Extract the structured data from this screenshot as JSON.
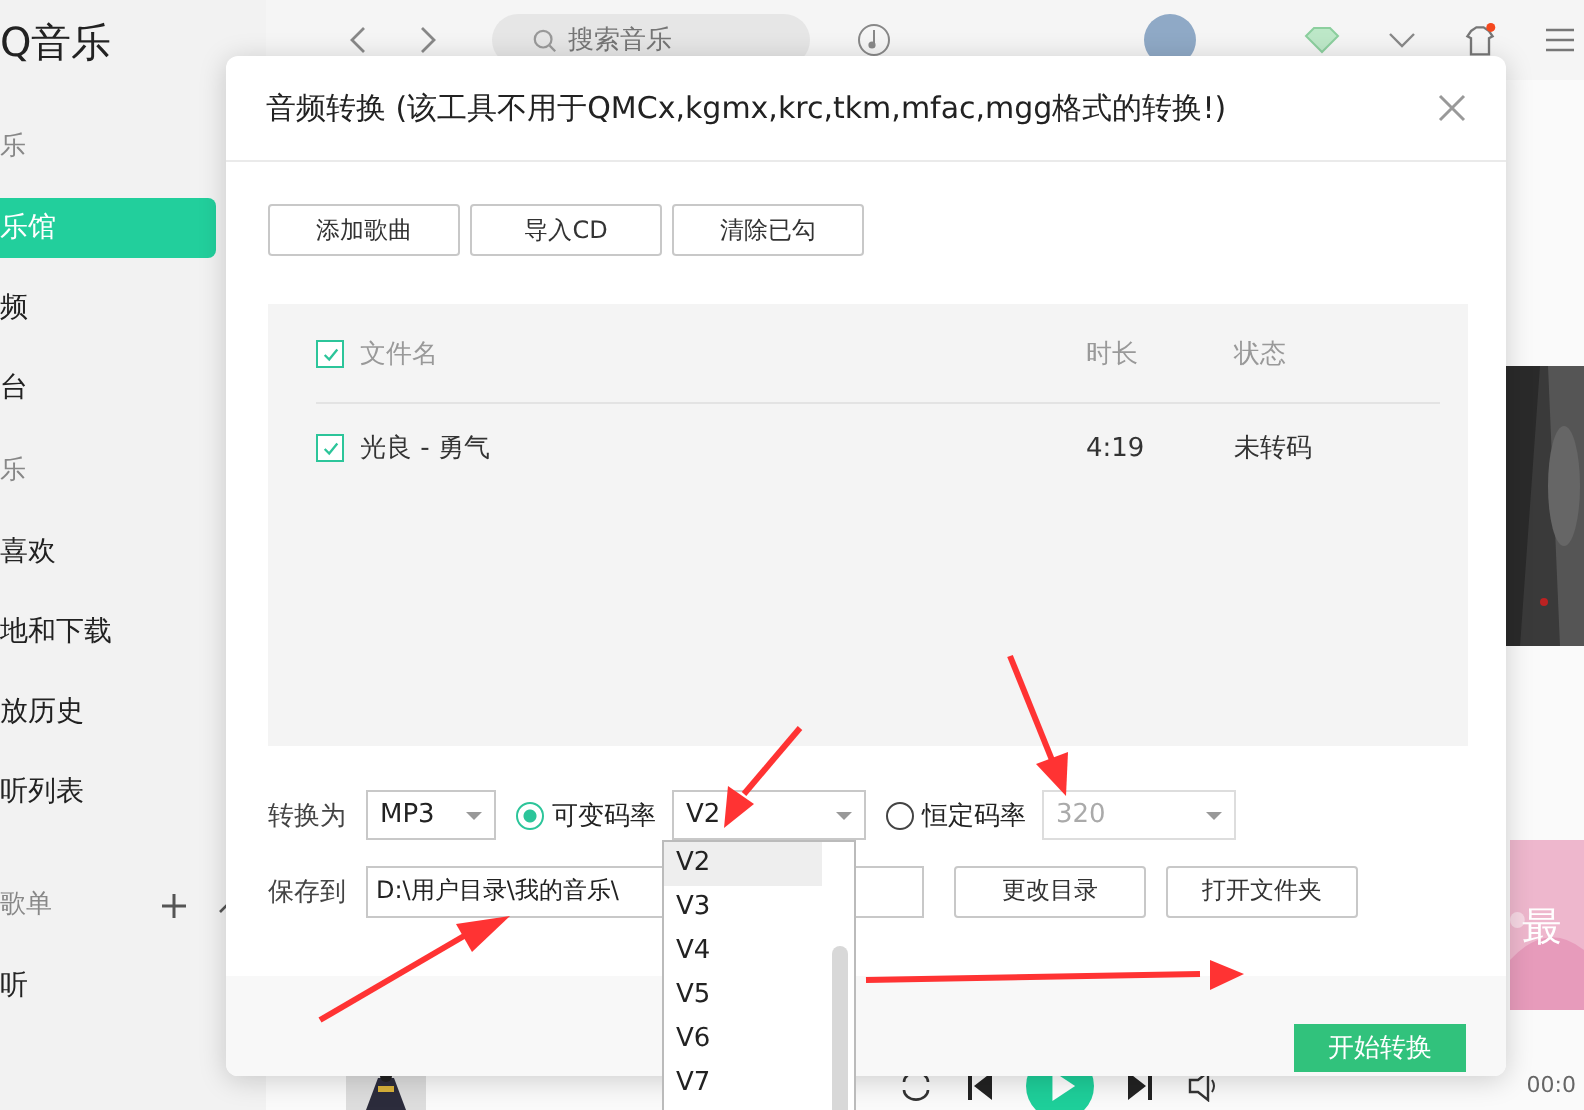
{
  "app": {
    "logo": "Q音乐",
    "search_placeholder": "搜索音乐",
    "time": "00:0",
    "card_text": "最"
  },
  "sidebar": [
    {
      "kind": "heading",
      "label": "乐"
    },
    {
      "kind": "item",
      "label": "乐馆",
      "selected": true
    },
    {
      "kind": "item",
      "label": "频",
      "selected": false
    },
    {
      "kind": "item",
      "label": "台",
      "selected": false
    },
    {
      "kind": "heading",
      "label": "乐"
    },
    {
      "kind": "item",
      "label": "喜欢",
      "selected": false
    },
    {
      "kind": "item",
      "label": "地和下载",
      "selected": false
    },
    {
      "kind": "item",
      "label": "放历史",
      "selected": false
    },
    {
      "kind": "item",
      "label": "听列表",
      "selected": false
    },
    {
      "kind": "playlist-heading",
      "label": "歌单"
    },
    {
      "kind": "item",
      "label": "听",
      "selected": false
    }
  ],
  "dialog": {
    "title": "音频转换 (该工具不用于QMCx,kgmx,krc,tkm,mfac,mgg格式的转换!)",
    "toolbar": [
      "添加歌曲",
      "导入CD",
      "清除已勾"
    ],
    "table": {
      "columns": [
        "文件名",
        "时长",
        "状态"
      ],
      "all_checked": true,
      "rows": [
        {
          "name": "光良 - 勇气",
          "duration": "4:19",
          "status": "未转码",
          "checked": true
        }
      ]
    },
    "convert_label": "转换为",
    "format": "MP3",
    "modes": [
      {
        "label": "可变码率",
        "value": "V2",
        "selected": true,
        "disabled": false
      },
      {
        "label": "恒定码率",
        "value": "320",
        "selected": false,
        "disabled": true
      }
    ],
    "save_label": "保存到",
    "save_path": "D:\\用户目录\\我的音乐\\",
    "save_buttons": [
      "更改目录",
      "打开文件夹"
    ],
    "start_button": "开始转换",
    "dropdown": [
      {
        "label": "V2",
        "selected": true
      },
      {
        "label": "V3",
        "selected": false
      },
      {
        "label": "V4",
        "selected": false
      },
      {
        "label": "V5",
        "selected": false
      },
      {
        "label": "V6",
        "selected": false
      },
      {
        "label": "V7",
        "selected": false
      }
    ]
  }
}
